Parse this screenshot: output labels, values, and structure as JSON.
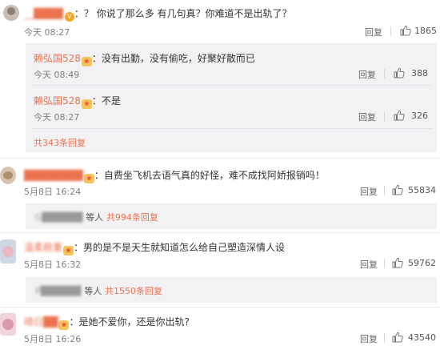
{
  "comments": [
    {
      "user": "__████",
      "text": "：？ 你说了那么多 有几句真？你难道不是出轨了？",
      "time": "今天 08:27",
      "reply_label": "回复",
      "likes": "1865",
      "replies": [
        {
          "user": "赖弘国528",
          "text": "：没有出勤，没有偷吃，好聚好散而已",
          "time": "今天 08:49",
          "reply_label": "回复",
          "likes": "388"
        },
        {
          "user": "赖弘国528",
          "text": "：不是",
          "time": "今天 08:27",
          "reply_label": "回复",
          "likes": "326"
        }
      ],
      "more_replies": "共343条回复"
    },
    {
      "user": "████████",
      "text": "：自费坐飞机去语气真的好怪，难不成找阿娇报销吗！",
      "time": "5月8日 16:24",
      "reply_label": "回复",
      "likes": "55834",
      "summary_user": "G██████",
      "summary_text": "等人",
      "summary_count": "共994条回复"
    },
    {
      "user": "温柔稳重",
      "text": "：男的是不是天生就知道怎么给自己塑造深情人设",
      "time": "5月8日 16:32",
      "reply_label": "回复",
      "likes": "59762",
      "summary_user": "P██████",
      "summary_text": "等人",
      "summary_count": "共1550条回复"
    },
    {
      "user": "晴日██",
      "text": "：是她不爱你，还是你出轨?",
      "time": "5月8日 16:26",
      "reply_label": "回复",
      "likes": "43540"
    }
  ],
  "colors": {
    "username": "#eb7350",
    "time": "#808080",
    "subbox_bg": "#f2f2f5"
  },
  "icons": [
    "thumbs-up-icon",
    "vip-badge-icon",
    "avatar"
  ]
}
